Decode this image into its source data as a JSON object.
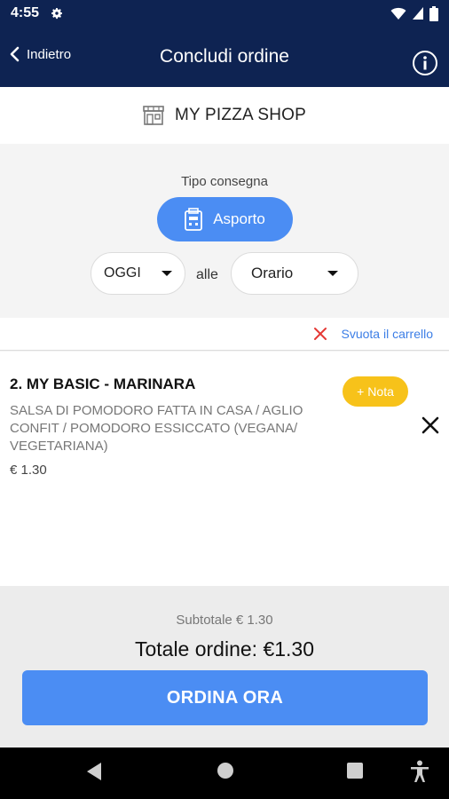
{
  "status_bar": {
    "time": "4:55"
  },
  "app_bar": {
    "back_label": "Indietro",
    "title": "Concludi ordine"
  },
  "shop": {
    "name": "MY PIZZA SHOP"
  },
  "delivery": {
    "type_label": "Tipo consegna",
    "selected_type": "Asporto",
    "day_value": "OGGI",
    "connector": "alle",
    "time_value": "Orario"
  },
  "cart": {
    "empty_label": "Svuota il carrello"
  },
  "items": [
    {
      "name": "2. MY BASIC - MARINARA",
      "description": "SALSA DI POMODORO FATTA IN CASA  / AGLIO CONFIT / POMODORO ESSICCATO   (VEGANA/ VEGETARIANA)",
      "price": "€ 1.30",
      "note_label": "Nota"
    }
  ],
  "summary": {
    "subtotal": "Subtotale  € 1.30",
    "total": "Totale ordine: €1.30",
    "order_button": "ORDINA ORA"
  },
  "colors": {
    "primary_dark": "#0e2352",
    "accent_blue": "#4b8df3",
    "note_yellow": "#f7c21a",
    "remove_red": "#e53935"
  }
}
